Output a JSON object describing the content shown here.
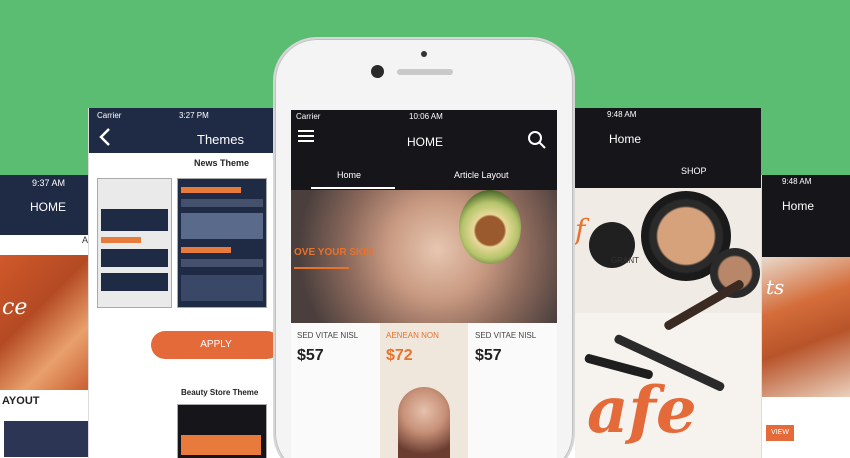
{
  "screens": {
    "left": {
      "time": "9:37 AM",
      "title": "HOME",
      "side_letter": "A",
      "hero_text": "ce",
      "section_label": "AYOUT"
    },
    "themes": {
      "carrier": "Carrier",
      "time": "3:27 PM",
      "title": "Themes",
      "news_label": "News Theme",
      "apply_label": "APPLY",
      "beauty_label": "Beauty Store Theme"
    },
    "center": {
      "carrier": "Carrier",
      "time": "10:06 AM",
      "title": "HOME",
      "tabs": [
        {
          "label": "Home"
        },
        {
          "label": "Article Layout"
        }
      ],
      "hero_text": "OVE YOUR SKIN",
      "products": [
        {
          "name": "SED VITAE NISL",
          "price": "$57"
        },
        {
          "name": "AENEAN NON",
          "price": "$72"
        },
        {
          "name": "SED VITAE NISL",
          "price": "$57"
        }
      ]
    },
    "shop": {
      "time": "9:48 AM",
      "title": "Home",
      "tab": "SHOP",
      "brand_letter": "f",
      "brand_caption": "GRANT",
      "overlay_text": "afe"
    },
    "right": {
      "time": "9:48 AM",
      "title": "Home",
      "hero_text": "ts",
      "button_label": "VIEW"
    }
  },
  "colors": {
    "background_green": "#5bbd72",
    "navy_bar": "#1f2a45",
    "dark_bar": "#16151a",
    "accent_orange": "#e46a3a"
  }
}
